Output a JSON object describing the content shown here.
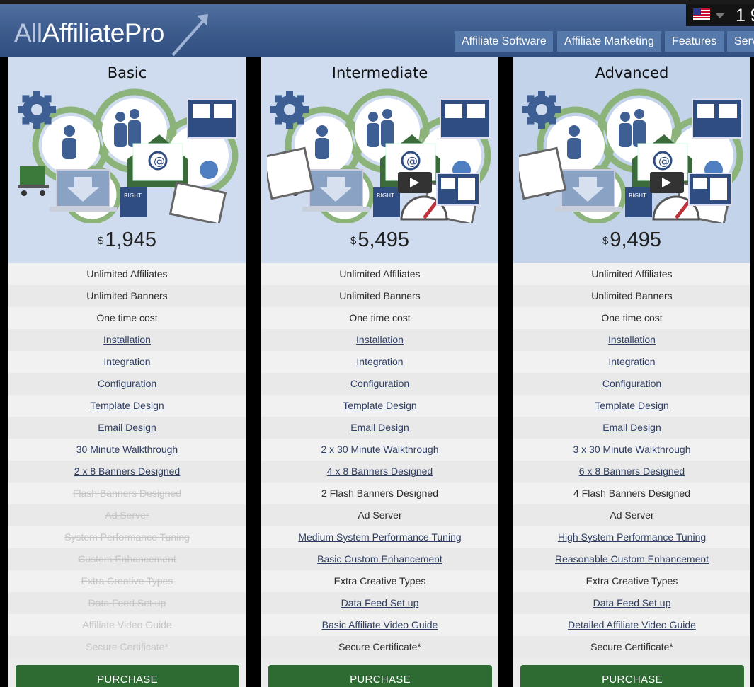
{
  "header": {
    "logo_part1": "All",
    "logo_part2": "AffiliatePro",
    "phone_partial": "1 9",
    "nav": [
      "Affiliate Software",
      "Affiliate Marketing",
      "Features",
      "Serv"
    ]
  },
  "plans": [
    {
      "name": "Basic",
      "currency": "$",
      "price": "1,945",
      "features": [
        {
          "text": "Unlimited Affiliates",
          "style": "plain"
        },
        {
          "text": "Unlimited Banners",
          "style": "plain"
        },
        {
          "text": "One time cost",
          "style": "plain"
        },
        {
          "text": "Installation",
          "style": "link"
        },
        {
          "text": "Integration",
          "style": "link"
        },
        {
          "text": "Configuration",
          "style": "link"
        },
        {
          "text": "Template Design",
          "style": "link"
        },
        {
          "text": "Email Design",
          "style": "link"
        },
        {
          "text": "30 Minute Walkthrough",
          "style": "link"
        },
        {
          "text": "2 x 8 Banners Designed",
          "style": "link"
        },
        {
          "text": "Flash Banners Designed",
          "style": "off"
        },
        {
          "text": "Ad Server",
          "style": "off"
        },
        {
          "text": "System Performance Tuning",
          "style": "off"
        },
        {
          "text": "Custom Enhancement",
          "style": "off"
        },
        {
          "text": "Extra Creative Types",
          "style": "off"
        },
        {
          "text": "Data Feed Set up",
          "style": "off"
        },
        {
          "text": "Affiliate Video Guide",
          "style": "off"
        },
        {
          "text": "Secure Certificate*",
          "style": "off"
        }
      ],
      "button": "PURCHASE"
    },
    {
      "name": "Intermediate",
      "currency": "$",
      "price": "5,495",
      "features": [
        {
          "text": "Unlimited Affiliates",
          "style": "plain"
        },
        {
          "text": "Unlimited Banners",
          "style": "plain"
        },
        {
          "text": "One time cost",
          "style": "plain"
        },
        {
          "text": "Installation",
          "style": "link"
        },
        {
          "text": "Integration",
          "style": "link"
        },
        {
          "text": "Configuration",
          "style": "link"
        },
        {
          "text": "Template Design",
          "style": "link"
        },
        {
          "text": "Email Design",
          "style": "link"
        },
        {
          "text": "2 x 30 Minute Walkthrough",
          "style": "link"
        },
        {
          "text": "4 x 8 Banners Designed",
          "style": "link"
        },
        {
          "text": "2 Flash Banners Designed",
          "style": "plain"
        },
        {
          "text": "Ad Server",
          "style": "plain"
        },
        {
          "text": "Medium System Performance Tuning",
          "style": "link"
        },
        {
          "text": "Basic Custom Enhancement",
          "style": "link"
        },
        {
          "text": "Extra Creative Types",
          "style": "plain"
        },
        {
          "text": "Data Feed Set up",
          "style": "link"
        },
        {
          "text": "Basic Affiliate Video Guide",
          "style": "link"
        },
        {
          "text": "Secure Certificate*",
          "style": "plain"
        }
      ],
      "button": "PURCHASE"
    },
    {
      "name": "Advanced",
      "currency": "$",
      "price": "9,495",
      "features": [
        {
          "text": "Unlimited Affiliates",
          "style": "plain"
        },
        {
          "text": "Unlimited Banners",
          "style": "plain"
        },
        {
          "text": "One time cost",
          "style": "plain"
        },
        {
          "text": "Installation",
          "style": "link"
        },
        {
          "text": "Integration",
          "style": "link"
        },
        {
          "text": "Configuration",
          "style": "link"
        },
        {
          "text": "Template Design",
          "style": "link"
        },
        {
          "text": "Email Design",
          "style": "link"
        },
        {
          "text": "3 x 30 Minute Walkthrough",
          "style": "link"
        },
        {
          "text": "6 x 8 Banners Designed",
          "style": "link"
        },
        {
          "text": "4 Flash Banners Designed",
          "style": "plain"
        },
        {
          "text": "Ad Server",
          "style": "plain"
        },
        {
          "text": "High System Performance Tuning",
          "style": "link"
        },
        {
          "text": "Reasonable Custom Enhancement",
          "style": "link"
        },
        {
          "text": "Extra Creative Types",
          "style": "plain"
        },
        {
          "text": "Data Feed Set up",
          "style": "link"
        },
        {
          "text": "Detailed Affiliate Video Guide",
          "style": "link"
        },
        {
          "text": "Secure Certificate*",
          "style": "plain"
        }
      ],
      "button": "PURCHASE"
    }
  ],
  "colors": {
    "header": "#3c5b8c",
    "nav_item": "#5679ab",
    "purchase_button": "#2e6b33",
    "link": "#2e3e63",
    "disabled": "#c5c5c5"
  }
}
